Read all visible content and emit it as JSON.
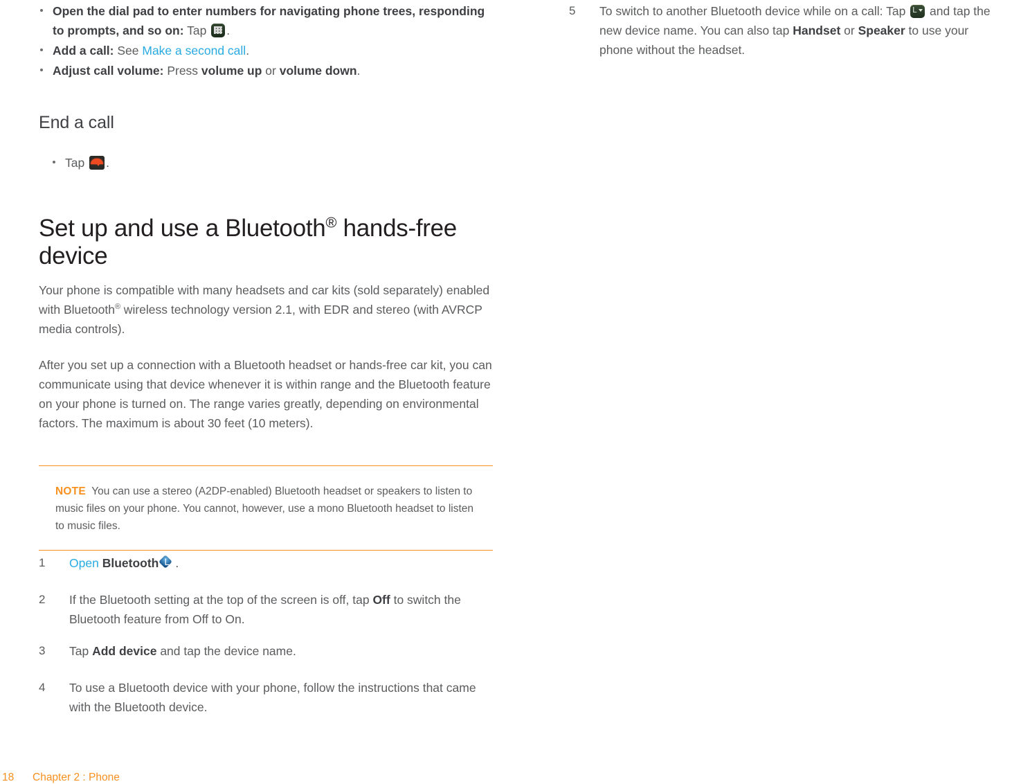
{
  "document": {
    "footer": {
      "page_number": "18",
      "chapter": "Chapter 2 : Phone"
    }
  },
  "left_column": {
    "bullets": [
      {
        "lead": "Open the dial pad to enter numbers for navigating phone trees, responding to prompts, and so on:",
        "rest_before_icon": " Tap ",
        "icon": "dialpad-icon",
        "rest_after_icon": "."
      },
      {
        "lead": "Add a call:",
        "rest_before_link": " See ",
        "link": "Make a second call",
        "rest_after_link": "."
      },
      {
        "lead": "Adjust call volume:",
        "text_1": " Press ",
        "bold_1": "volume up",
        "text_2": " or ",
        "bold_2": "volume down",
        "text_3": "."
      }
    ],
    "heading_end_call": "End a call",
    "end_call_bullet": {
      "text_before_icon": "Tap ",
      "icon": "end-call-icon",
      "text_after_icon": "."
    },
    "heading_main_part1": "Set up and use a Bluetooth",
    "heading_main_sup": "®",
    "heading_main_part2": " hands-free device",
    "paragraph_1_part1": "Your phone is compatible with many headsets and car kits (sold separately) enabled with Bluetooth",
    "paragraph_1_sup": "®",
    "paragraph_1_part2": " wireless technology version 2.1, with EDR and stereo (with AVRCP media controls).",
    "paragraph_2": "After you set up a connection with a Bluetooth headset or hands-free car kit, you can communicate using that device whenever it is within range and the Bluetooth feature on your phone is turned on. The range varies greatly, depending on environmental factors. The maximum is about 30 feet (10 meters).",
    "note": {
      "label": "NOTE",
      "text": "You can use a stereo (A2DP-enabled) Bluetooth headset or speakers to listen to music files on your phone. You cannot, however, use a mono Bluetooth headset to listen to music files."
    },
    "steps": [
      {
        "number": "1",
        "link": "Open",
        "bold": "Bluetooth",
        "icon": "bluetooth-icon",
        "tail": "."
      },
      {
        "number": "2",
        "text_1": "If the Bluetooth setting at the top of the screen is off, tap ",
        "bold_1": "Off",
        "text_2": " to switch the Bluetooth feature from Off to On."
      },
      {
        "number": "3",
        "text_1": "Tap ",
        "bold_1": "Add device",
        "text_2": " and tap the device name."
      },
      {
        "number": "4",
        "text_1": "To use a Bluetooth device with your phone, follow the instructions that came with the Bluetooth device."
      }
    ]
  },
  "right_column": {
    "steps": [
      {
        "number": "5",
        "text_1": "To switch to another Bluetooth device while on a call: Tap ",
        "icon": "bluetooth-audio-icon",
        "text_2": " and tap the new device name. You can also tap ",
        "bold_1": "Handset",
        "text_3": " or ",
        "bold_2": "Speaker",
        "text_4": " to use your phone without the headset."
      }
    ]
  },
  "colors": {
    "accent_orange": "#f7901e",
    "link_blue": "#29abe2",
    "body_gray": "#5b5c5e",
    "heading_dark": "#231f20"
  }
}
